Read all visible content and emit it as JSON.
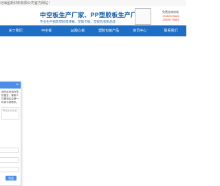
{
  "topbar": {
    "welcome": "河海盈新材料有限公司官方网站！"
  },
  "header": {
    "title": "中空板生产厂家、PP塑胶板生产厂家",
    "subtitle": "专业生产销售塑胶周转箱、塑胶卡板、塑胶包装制品等",
    "contact_label": "免费咨询热线",
    "phones": [
      "13352023583",
      "13600275883"
    ]
  },
  "nav": {
    "items": [
      {
        "label": "关于我们"
      },
      {
        "label": "中空板"
      },
      {
        "label": "pp胶心板"
      },
      {
        "label": "塑胶包装产品"
      },
      {
        "label": "资讯中心"
      },
      {
        "label": "联系我们"
      }
    ]
  },
  "chat": {
    "close": "×",
    "message": "请在此处填写您的留言，客服人员看到后会第一时间与您联系。",
    "placeholder": "请在此处留言",
    "send": "发送"
  },
  "colors": {
    "nav_bg": "#1d6ec4",
    "title": "#1a5fa8",
    "phone": "#e0331b",
    "chat_accent": "#4d8de8"
  }
}
